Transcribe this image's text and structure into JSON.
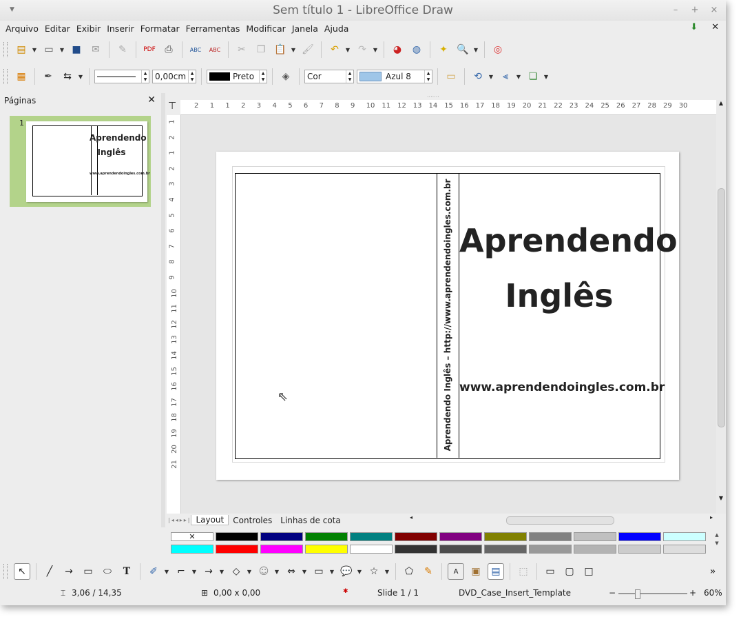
{
  "window": {
    "title": "Sem título 1 - LibreOffice Draw"
  },
  "menu": [
    "Arquivo",
    "Editar",
    "Exibir",
    "Inserir",
    "Formatar",
    "Ferramentas",
    "Modificar",
    "Janela",
    "Ajuda"
  ],
  "line_props": {
    "line_width": "0,00cm",
    "line_color": "Preto",
    "fill_type": "Cor",
    "fill_color": "Azul 8"
  },
  "panel": {
    "title": "Páginas",
    "slide_number": "1"
  },
  "thumbnail": {
    "title1": "Aprendendo",
    "title2": "Inglês",
    "url": "www.aprendendoingles.com.br"
  },
  "ruler": {
    "top": [
      "2",
      "1",
      "1",
      "2",
      "3",
      "4",
      "5",
      "6",
      "7",
      "8",
      "9",
      "10",
      "11",
      "12",
      "13",
      "14",
      "15",
      "16",
      "17",
      "18",
      "19",
      "20",
      "21",
      "22",
      "23",
      "24",
      "25",
      "26",
      "27",
      "28",
      "29",
      "30"
    ],
    "left": [
      "1",
      "2",
      "1",
      "2",
      "3",
      "4",
      "5",
      "6",
      "7",
      "8",
      "9",
      "10",
      "11",
      "12",
      "13",
      "14",
      "15",
      "16",
      "17",
      "18",
      "19",
      "20",
      "21"
    ]
  },
  "document": {
    "title_line1": "Aprendendo",
    "title_line2": "Inglês",
    "url": "www.aprendendoingles.com.br",
    "spine_text": "Aprendendo Inglês – http://www.aprendendoingles.com.br"
  },
  "tabs": [
    "Layout",
    "Controles",
    "Linhas de cota"
  ],
  "palette": {
    "row1": [
      "#ffffff",
      "#000000",
      "#000080",
      "#008000",
      "#008080",
      "#800000",
      "#800080",
      "#808000",
      "#808080",
      "#c0c0c0",
      "#0000ff",
      "#ccffff"
    ],
    "row2": [
      "#00ffff",
      "#ff0000",
      "#ff00ff",
      "#ffff00",
      "#ffffff",
      "#333333",
      "#4d4d4d",
      "#666666",
      "#999999",
      "#b3b3b3",
      "#cccccc",
      "#dddddd"
    ]
  },
  "status": {
    "position": "3,06 / 14,35",
    "size": "0,00 x 0,00",
    "slide": "Slide 1 / 1",
    "template": "DVD_Case_Insert_Template",
    "zoom": "60%"
  }
}
